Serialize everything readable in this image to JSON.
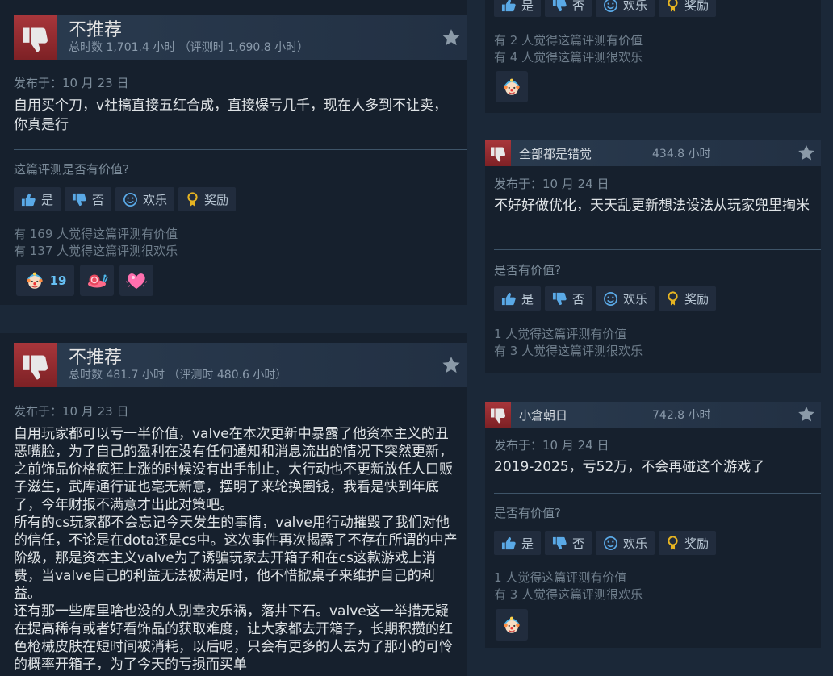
{
  "review1": {
    "verdict": "不推荐",
    "hours": "总时数 1,701.4 小时 （评测时 1,690.8 小时）",
    "posted": "发布于：10 月 23 日",
    "text": "自用买个刀，v社搞直接五红合成，直接爆亏几千，现在人多到不让卖，你真是行",
    "helpful_question": "这篇评测是否有价值?",
    "buttons": {
      "yes": "是",
      "no": "否",
      "funny": "欢乐",
      "award": "奖励"
    },
    "helpful_count": "有 169 人觉得这篇评测有价值",
    "funny_count": "有 137 人觉得这篇评测很欢乐",
    "awards": [
      {
        "icon": "clown-face-icon",
        "count": "19"
      },
      {
        "icon": "snail-icon"
      },
      {
        "icon": "heart-icon"
      }
    ]
  },
  "review2": {
    "verdict": "不推荐",
    "hours": "总时数 481.7 小时 （评测时 480.6 小时）",
    "posted": "发布于：10 月 23 日",
    "text": "自用玩家都可以亏一半价值，valve在本次更新中暴露了他资本主义的丑恶嘴脸，为了自己的盈利在没有任何通知和消息流出的情况下突然更新，之前饰品价格疯狂上涨的时候没有出手制止，大行动也不更新放任人口贩子滋生，武库通行证也毫无新意，摆明了来轮换圈钱，我看是快到年底了，今年财报不满意才出此对策吧。\n所有的cs玩家都不会忘记今天发生的事情，valve用行动摧毁了我们对他的信任，不论是在dota还是cs中。这次事件再次揭露了不存在所谓的中产阶级，那是资本主义valve为了诱骗玩家去开箱子和在cs这款游戏上消费，当valve自己的利益无法被满足时，他不惜掀桌子来维护自己的利益。\n还有那一些库里啥也没的人别幸灾乐祸，落井下石。valve这一举措无疑在提高稀有或者好看饰品的获取难度，让大家都去开箱子，长期积攒的红色枪械皮肤在短时间被消耗，以后呢，只会有更多的人去为了那小的可怜的概率开箱子，为了今天的亏损而买单"
  },
  "review3": {
    "buttons": {
      "yes": "是",
      "no": "否",
      "funny": "欢乐",
      "award": "奖励"
    },
    "helpful_count": "有 2 人觉得这篇评测有价值",
    "funny_count": "有 4 人觉得这篇评测很欢乐",
    "awards": [
      {
        "icon": "clown-face-icon"
      }
    ]
  },
  "review4": {
    "username": "全部都是错觉",
    "hours": "434.8 小时",
    "posted": "发布于：10 月 24 日",
    "text": "不好好做优化，天天乱更新想法设法从玩家兜里掏米",
    "helpful_question": "是否有价值?",
    "buttons": {
      "yes": "是",
      "no": "否",
      "funny": "欢乐",
      "award": "奖励"
    },
    "helpful_count": "1 人觉得这篇评测有价值",
    "funny_count": "有 3 人觉得这篇评测很欢乐"
  },
  "review5": {
    "username": "小倉朝日",
    "hours": "742.8 小时",
    "posted": "发布于：10 月 24 日",
    "text": "2019-2025，亏52万，不会再碰这个游戏了",
    "helpful_question": "是否有价值?",
    "buttons": {
      "yes": "是",
      "no": "否",
      "funny": "欢乐",
      "award": "奖励"
    },
    "helpful_count": "1 人觉得这篇评测有价值",
    "funny_count": "有 3 人觉得这篇评测很欢乐",
    "awards": [
      {
        "icon": "clown-face-icon"
      }
    ]
  },
  "colors": {
    "page_bg": "#1b2838",
    "card_bg": "#16202d",
    "thumb_red": "#a8363b",
    "accent_blue": "#66c0f4",
    "award_gold": "#e6b422"
  }
}
